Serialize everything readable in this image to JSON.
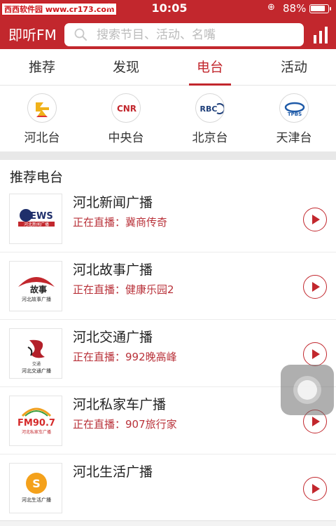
{
  "status_bar": {
    "watermark": "西西软件园 www.cr173.com",
    "time": "10:05",
    "battery": "88%",
    "battery_level": 0.88
  },
  "header": {
    "app_title": "即听FM",
    "search_placeholder": "搜索节目、活动、名嘴",
    "search_value": ""
  },
  "tabs": [
    {
      "label": "推荐",
      "active": false
    },
    {
      "label": "发现",
      "active": false
    },
    {
      "label": "电台",
      "active": true
    },
    {
      "label": "活动",
      "active": false
    }
  ],
  "stations": [
    {
      "label": "河北台",
      "logo": "hebei-logo"
    },
    {
      "label": "中央台",
      "logo": "CNR"
    },
    {
      "label": "北京台",
      "logo": "RBC"
    },
    {
      "label": "天津台",
      "logo": "TPBS"
    }
  ],
  "section_title": "推荐电台",
  "radio_list": [
    {
      "name": "河北新闻广播",
      "live": "正在直播：冀商传奇",
      "logo_text": "NEWS",
      "logo_sub": "河北新闻广播"
    },
    {
      "name": "河北故事广播",
      "live": "正在直播：健康乐园2",
      "logo_text": "故事",
      "logo_sub": "河北故事广播"
    },
    {
      "name": "河北交通广播",
      "live": "正在直播：992晚高峰",
      "logo_text": "交通",
      "logo_sub": "河北交通广播"
    },
    {
      "name": "河北私家车广播",
      "live": "正在直播：907旅行家",
      "logo_text": "FM90.7",
      "logo_sub": "河北私家车广播"
    },
    {
      "name": "河北生活广播",
      "live": "",
      "logo_text": "S",
      "logo_sub": "河北生活广播"
    }
  ],
  "colors": {
    "brand": "#c2272d",
    "live_text": "#b9323a"
  },
  "icons": {
    "search": "search-icon",
    "rank": "rank-icon",
    "play": "play-icon",
    "assistive": "assistive-touch-icon"
  }
}
